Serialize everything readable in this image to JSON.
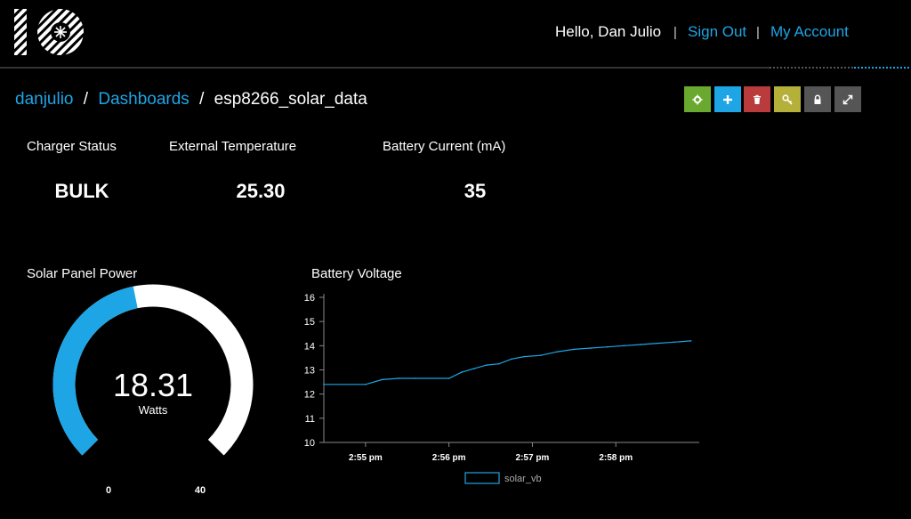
{
  "header": {
    "logo": "io-logo-icon",
    "greeting": "Hello, Dan Julio",
    "separator": "|",
    "sign_out": "Sign Out",
    "my_account": "My Account"
  },
  "breadcrumb": {
    "user": "danjulio",
    "slash": "/",
    "dashboards": "Dashboards",
    "current": "esp8266_solar_data"
  },
  "toolbar": {
    "buttons": [
      {
        "name": "settings",
        "icon": "gear-icon",
        "color": "#6aa92f"
      },
      {
        "name": "add",
        "icon": "plus-icon",
        "color": "#1ea5e6"
      },
      {
        "name": "delete",
        "icon": "trash-icon",
        "color": "#b93b3b"
      },
      {
        "name": "key",
        "icon": "key-icon",
        "color": "#b5b03a"
      },
      {
        "name": "lock",
        "icon": "lock-icon",
        "color": "#555555"
      },
      {
        "name": "fullscreen",
        "icon": "expand-icon",
        "color": "#555555"
      }
    ]
  },
  "stats": {
    "charger_status": {
      "label": "Charger Status",
      "value": "BULK"
    },
    "external_temperature": {
      "label": "External Temperature",
      "value": "25.30"
    },
    "battery_current": {
      "label": "Battery Current (mA)",
      "value": "35"
    }
  },
  "gauge": {
    "title": "Solar Panel Power",
    "value": 18.31,
    "value_text": "18.31",
    "unit": "Watts",
    "min": 0,
    "max": 40,
    "min_label": "0",
    "max_label": "40",
    "fill_color": "#1ea5e6",
    "track_color": "#ffffff"
  },
  "chart_title": "Battery Voltage",
  "chart_data": {
    "type": "line",
    "title": "Battery Voltage",
    "xlabel": "",
    "ylabel": "",
    "ylim": [
      10,
      16
    ],
    "y_ticks": [
      "10",
      "11",
      "12",
      "13",
      "14",
      "15",
      "16"
    ],
    "x_tick_labels": [
      "2:55 pm",
      "2:56 pm",
      "2:57 pm",
      "2:58 pm"
    ],
    "x_ticks_minutes": [
      55,
      56,
      57,
      58
    ],
    "xlim": [
      54.5,
      59.0
    ],
    "grid": false,
    "legend_position": "bottom",
    "series": [
      {
        "name": "solar_vb",
        "color": "#1ea5e6",
        "x": [
          54.5,
          55.0,
          55.2,
          55.4,
          55.6,
          56.0,
          56.15,
          56.3,
          56.45,
          56.6,
          56.75,
          56.9,
          57.1,
          57.3,
          57.5,
          57.7,
          57.9,
          58.1,
          58.3,
          58.5,
          58.7,
          58.9
        ],
        "y": [
          12.4,
          12.4,
          12.6,
          12.65,
          12.65,
          12.65,
          12.9,
          13.05,
          13.2,
          13.25,
          13.45,
          13.55,
          13.6,
          13.75,
          13.85,
          13.9,
          13.95,
          14.0,
          14.05,
          14.1,
          14.15,
          14.2
        ]
      }
    ]
  }
}
